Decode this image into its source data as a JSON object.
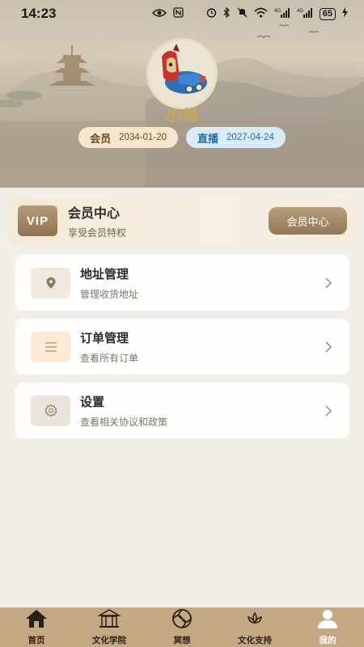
{
  "status_bar": {
    "time": "14:23",
    "battery": "65",
    "icons": [
      "eye-icon",
      "nfc-icon",
      "alarm-icon",
      "bluetooth-icon",
      "mute-icon",
      "wifi-icon",
      "signal-4g-icon",
      "signal-4g-icon",
      "charging-icon"
    ]
  },
  "profile": {
    "username": "小何",
    "member_label": "会员",
    "member_date": "2034-01-20",
    "live_label": "直播",
    "live_date": "2027-04-24"
  },
  "vip": {
    "logo": "VIP",
    "title": "会员中心",
    "subtitle": "享受会员特权",
    "button_label": "会员中心"
  },
  "menu": [
    {
      "title": "地址管理",
      "subtitle": "管理收货地址",
      "icon": "location-pin-icon"
    },
    {
      "title": "订单管理",
      "subtitle": "查看所有订单",
      "icon": "list-icon"
    },
    {
      "title": "设置",
      "subtitle": "查看相关协议和政策",
      "icon": "gear-icon"
    }
  ],
  "bottom_nav": [
    {
      "label": "首页",
      "icon": "home-icon",
      "active": false
    },
    {
      "label": "文化学院",
      "icon": "temple-icon",
      "active": false
    },
    {
      "label": "冥想",
      "icon": "swirl-icon",
      "active": false
    },
    {
      "label": "文化支持",
      "icon": "lotus-icon",
      "active": false
    },
    {
      "label": "我的",
      "icon": "person-icon",
      "active": true
    }
  ],
  "colors": {
    "accent": "#a88d68",
    "nav_bg": "#c4a884",
    "username": "#d2a93c",
    "live_badge_text": "#2c6d9c"
  }
}
